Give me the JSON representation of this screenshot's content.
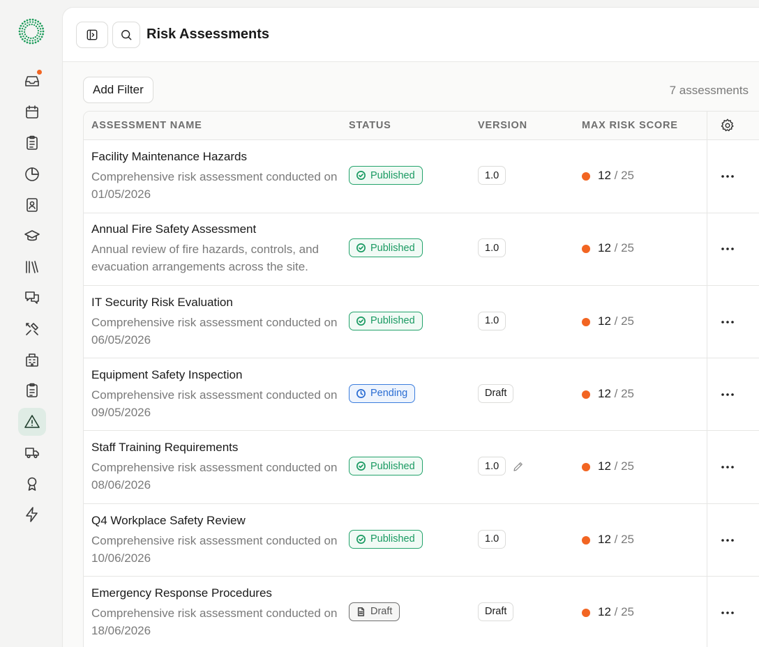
{
  "header": {
    "title": "Risk Assessments"
  },
  "toolbar": {
    "add_filter_label": "Add Filter",
    "count_label": "7 assessments"
  },
  "table": {
    "columns": [
      "ASSESSMENT NAME",
      "STATUS",
      "VERSION",
      "MAX RISK SCORE"
    ],
    "rows": [
      {
        "name": "Facility Maintenance Hazards",
        "desc": "Comprehensive risk assessment conducted on 01/05/2026",
        "status": "Published",
        "version": "1.0",
        "score": "12",
        "max": "/ 25"
      },
      {
        "name": "Annual Fire Safety Assessment",
        "desc": "Annual review of fire hazards, controls, and evacuation arrangements across the site.",
        "status": "Published",
        "version": "1.0",
        "score": "12",
        "max": "/ 25"
      },
      {
        "name": "IT Security Risk Evaluation",
        "desc": "Comprehensive risk assessment conducted on 06/05/2026",
        "status": "Published",
        "version": "1.0",
        "score": "12",
        "max": "/ 25"
      },
      {
        "name": "Equipment Safety Inspection",
        "desc": "Comprehensive risk assessment conducted on 09/05/2026",
        "status": "Pending",
        "version": "Draft",
        "score": "12",
        "max": "/ 25"
      },
      {
        "name": "Staff Training Requirements",
        "desc": "Comprehensive risk assessment conducted on 08/06/2026",
        "status": "Published",
        "version": "1.0",
        "score": "12",
        "max": "/ 25"
      },
      {
        "name": "Q4 Workplace Safety Review",
        "desc": "Comprehensive risk assessment conducted on 10/06/2026",
        "status": "Published",
        "version": "1.0",
        "score": "12",
        "max": "/ 25"
      },
      {
        "name": "Emergency Response Procedures",
        "desc": "Comprehensive risk assessment conducted on 18/06/2026",
        "status": "Draft",
        "version": "Draft",
        "score": "12",
        "max": "/ 25"
      }
    ]
  },
  "colors": {
    "accent_green": "#1a9a62",
    "pending_blue": "#2a6dd3",
    "score_orange": "#f26522",
    "notify_orange": "#f26522",
    "active_nav_bg": "#dfece5"
  },
  "sidebar": {
    "items": [
      {
        "icon": "inbox-icon"
      },
      {
        "icon": "calendar-icon"
      },
      {
        "icon": "clipboard-list-icon"
      },
      {
        "icon": "pie-chart-icon"
      },
      {
        "icon": "contact-book-icon"
      },
      {
        "icon": "graduation-cap-icon"
      },
      {
        "icon": "library-icon"
      },
      {
        "icon": "messages-icon"
      },
      {
        "icon": "tools-icon"
      },
      {
        "icon": "building-icon"
      },
      {
        "icon": "clipboard-check-icon"
      },
      {
        "icon": "warning-icon",
        "active": true
      },
      {
        "icon": "truck-icon"
      },
      {
        "icon": "award-icon"
      },
      {
        "icon": "lightning-icon"
      }
    ]
  }
}
